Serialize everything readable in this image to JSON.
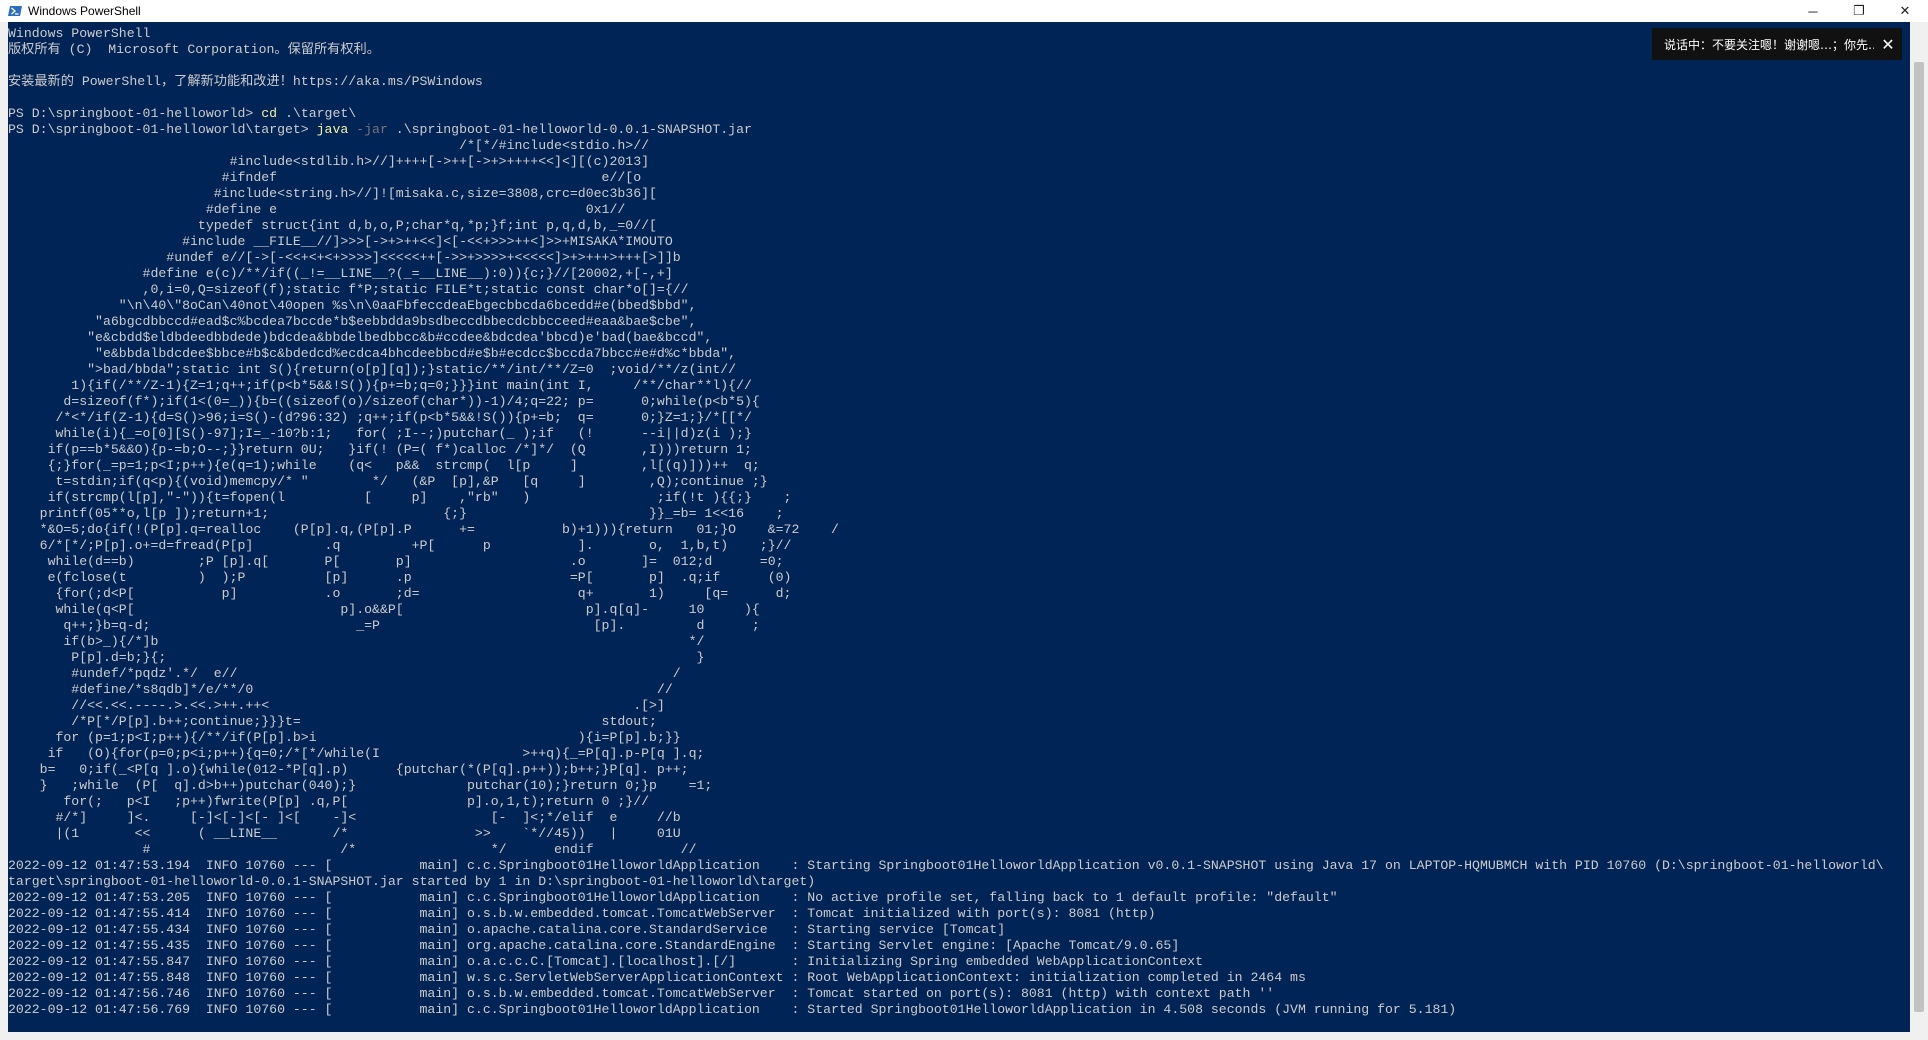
{
  "window": {
    "title": "Windows PowerShell",
    "minimize": "─",
    "maximize": "❐",
    "close": "✕"
  },
  "notification": {
    "text": "说话中：不要关注嗯！谢谢嗯…；你先…",
    "close": "✕"
  },
  "colors": {
    "console_bg": "#012456",
    "text": "#cccccc",
    "command": "#f9f1a5",
    "param": "#767676"
  },
  "console_lines": [
    [
      {
        "t": "Windows PowerShell",
        "c": "a"
      }
    ],
    [
      {
        "t": "版权所有 (C)  Microsoft Corporation。保留所有权利。",
        "c": "a"
      }
    ],
    [
      {
        "t": "",
        "c": "a"
      }
    ],
    [
      {
        "t": "安装最新的 PowerShell，了解新功能和改进！https://aka.ms/PSWindows",
        "c": "a"
      }
    ],
    [
      {
        "t": "",
        "c": "a"
      }
    ],
    [
      {
        "t": "PS D:\\springboot-01-helloworld> ",
        "c": "a"
      },
      {
        "t": "cd",
        "c": "b"
      },
      {
        "t": " .\\target\\",
        "c": "a"
      }
    ],
    [
      {
        "t": "PS D:\\springboot-01-helloworld\\target> ",
        "c": "a"
      },
      {
        "t": "java",
        "c": "b"
      },
      {
        "t": " -jar",
        "c": "c"
      },
      {
        "t": " .\\springboot-01-helloworld-0.0.1-SNAPSHOT.jar",
        "c": "a"
      }
    ],
    [
      {
        "t": "                                                         /*[*/#include<stdio.h>//",
        "c": "a"
      }
    ],
    [
      {
        "t": "                            #include<stdlib.h>//]++++[->++[->+>++++<<]<][(c)2013]",
        "c": "a"
      }
    ],
    [
      {
        "t": "                           #ifndef                                         e//[o",
        "c": "a"
      }
    ],
    [
      {
        "t": "                          #include<string.h>//]![misaka.c,size=3808,crc=d0ec3b36][",
        "c": "a"
      }
    ],
    [
      {
        "t": "                         #define e                                       0x1//",
        "c": "a"
      }
    ],
    [
      {
        "t": "                        typedef struct{int d,b,o,P;char*q,*p;}f;int p,q,d,b,_=0//[",
        "c": "a"
      }
    ],
    [
      {
        "t": "                      #include __FILE__//]>>>[->+>++<<]<[-<<+>>>++<]>>+MISAKA*IMOUTO",
        "c": "a"
      }
    ],
    [
      {
        "t": "                    #undef e//[->[-<<+<+<+>>>>]<<<<<++[->>+>>>>+<<<<<]>+>+++>+++[>]]b",
        "c": "a"
      }
    ],
    [
      {
        "t": "                 #define e(c)/**/if((_!=__LINE__?(_=__LINE__):0)){c;}//[20002,+[-,+]",
        "c": "a"
      }
    ],
    [
      {
        "t": "                 ,0,i=0,Q=sizeof(f);static f*P;static FILE*t;static const char*o[]={//",
        "c": "a"
      }
    ],
    [
      {
        "t": "              \"\\n\\40\\\"8oCan\\40not\\40open %s\\n\\0aaFbfeccdeaEbgecbbcda6bcedd#e(bbed$bbd\",",
        "c": "a"
      }
    ],
    [
      {
        "t": "           \"a6bgcdbbccd#ead$c%bcdea7bccde*b$eebbdda9bsdbeccdbbecdcbbcceed#eaa&bae$cbe\",",
        "c": "a"
      }
    ],
    [
      {
        "t": "          \"e&cbdd$eldbdeedbbdede)bdcdea&bbdelbedbbcc&b#ccdee&bdcdea'bbcd)e'bad(bae&bccd\",",
        "c": "a"
      }
    ],
    [
      {
        "t": "           \"e&bbdalbdcdee$bbce#b$c&bdedcd%ecdca4bhcdeebbcd#e$b#ecdcc$bccda7bbcc#e#d%c*bbda\",",
        "c": "a"
      }
    ],
    [
      {
        "t": "          \">bad/bbda\";static int S(){return(o[p][q]);}static/**/int/**/Z=0  ;void/**/z(int//",
        "c": "a"
      }
    ],
    [
      {
        "t": "        1){if(/**/Z-1){Z=1;q++;if(p<b*5&&!S()){p+=b;q=0;}}}int main(int I,     /**/char**l){//",
        "c": "a"
      }
    ],
    [
      {
        "t": "       d=sizeof(f*);if(1<(0=_)){b=((sizeof(o)/sizeof(char*))-1)/4;q=22; p=      0;while(p<b*5){",
        "c": "a"
      }
    ],
    [
      {
        "t": "      /*<*/if(Z-1){d=S()>96;i=S()-(d?96:32) ;q++;if(p<b*5&&!S()){p+=b;  q=      0;}Z=1;}/*[[*/",
        "c": "a"
      }
    ],
    [
      {
        "t": "      while(i){_=o[0][S()-97];I=_-10?b:1;   for( ;I--;)putchar(_ );if   (!      --i||d)z(i );}",
        "c": "a"
      }
    ],
    [
      {
        "t": "     if(p==b*5&&O){p-=b;O--;}}return 0U;   }if(! (P=( f*)calloc /*]*/  (Q       ,I)))return 1;",
        "c": "a"
      }
    ],
    [
      {
        "t": "     {;}for(_=p=1;p<I;p++){e(q=1);while    (q<   p&&  strcmp(  l[p     ]        ,l[(q)]))++  q;",
        "c": "a"
      }
    ],
    [
      {
        "t": "      t=stdin;if(q<p){(void)memcpy/* \"        */   (&P  [p],&P   [q     ]        ,Q);continue ;}",
        "c": "a"
      }
    ],
    [
      {
        "t": "     if(strcmp(l[p],\"-\")){t=fopen(l          [     p]    ,\"rb\"   )                ;if(!t ){{;}    ;",
        "c": "a"
      }
    ],
    [
      {
        "t": "    printf(05**o,l[p ]);return+1;                      {;}                       }}_=b= 1<<16    ;",
        "c": "a"
      }
    ],
    [
      {
        "t": "    *&O=5;do{if(!(P[p].q=realloc    (P[p].q,(P[p].P      +=           b)+1))){return   01;}O    &=72    /",
        "c": "a"
      }
    ],
    [
      {
        "t": "    6/*[*/;P[p].o+=d=fread(P[p]         .q         +P[      p           ].       o,  1,b,t)    ;}//",
        "c": "a"
      }
    ],
    [
      {
        "t": "     while(d==b)        ;P [p].q[       P[       p]                    .o       ]=  012;d      =0;",
        "c": "a"
      }
    ],
    [
      {
        "t": "     e(fclose(t         )  );P          [p]      .p                    =P[       p]  .q;if      (0)",
        "c": "a"
      }
    ],
    [
      {
        "t": "      {for(;d<P[           p]           .o       ;d=                    q+       1)     [q=      d;",
        "c": "a"
      }
    ],
    [
      {
        "t": "      while(q<P[                          p].o&&P[                       p].q[q]-     10     ){",
        "c": "a"
      }
    ],
    [
      {
        "t": "       q++;}b=q-d;                          _=P                           [p].         d      ;",
        "c": "a"
      }
    ],
    [
      {
        "t": "       if(b>_){/*]b                                                                   */",
        "c": "a"
      }
    ],
    [
      {
        "t": "        P[p].d=b;}{;                                                                   }",
        "c": "a"
      }
    ],
    [
      {
        "t": "        #undef/*pqdz'.*/  e//                                                       /",
        "c": "a"
      }
    ],
    [
      {
        "t": "        #define/*s8qdb]*/e/**/0                                                   //",
        "c": "a"
      }
    ],
    [
      {
        "t": "        //<<.<<.----.>.<<.>++.++<                                              .[>]",
        "c": "a"
      }
    ],
    [
      {
        "t": "        /*P[*/P[p].b++;continue;}}}t=                                      stdout;",
        "c": "a"
      }
    ],
    [
      {
        "t": "      for (p=1;p<I;p++){/**/if(P[p].b>i                                 ){i=P[p].b;}}",
        "c": "a"
      }
    ],
    [
      {
        "t": "     if   (O){for(p=0;p<i;p++){q=0;/*[*/while(I                  >++q){_=P[q].p-P[q ].q;",
        "c": "a"
      }
    ],
    [
      {
        "t": "    b=   0;if(_<P[q ].o){while(012-*P[q].p)      {putchar(*(P[q].p++));b++;}P[q]. p++;",
        "c": "a"
      }
    ],
    [
      {
        "t": "    }   ;while  (P[  q].d>b++)putchar(040);}              putchar(10);}return 0;}p    =1;",
        "c": "a"
      }
    ],
    [
      {
        "t": "       for(;   p<I   ;p++)fwrite(P[p] .q,P[               p].o,1,t);return 0 ;}//",
        "c": "a"
      }
    ],
    [
      {
        "t": "      #/*]     ]<.     [-]<[-]<[- ]<[    -]<                 [-  ]<;*/elif  e     //b",
        "c": "a"
      }
    ],
    [
      {
        "t": "      |(1       <<      ( __LINE__       /*                >>    `*//45))   |     01U",
        "c": "a"
      }
    ],
    [
      {
        "t": "                 #                        /*                 */      endif           //",
        "c": "a"
      }
    ],
    [
      {
        "t": "2022-09-12 01:47:53.194  INFO 10760 --- [           main] c.c.Springboot01HelloworldApplication    : Starting Springboot01HelloworldApplication v0.0.1-SNAPSHOT using Java 17 on LAPTOP-HQMUBMCH with PID 10760 (D:\\springboot-01-helloworld\\",
        "c": "a"
      }
    ],
    [
      {
        "t": "target\\springboot-01-helloworld-0.0.1-SNAPSHOT.jar started by 1 in D:\\springboot-01-helloworld\\target)",
        "c": "a"
      }
    ],
    [
      {
        "t": "2022-09-12 01:47:53.205  INFO 10760 --- [           main] c.c.Springboot01HelloworldApplication    : No active profile set, falling back to 1 default profile: \"default\"",
        "c": "a"
      }
    ],
    [
      {
        "t": "2022-09-12 01:47:55.414  INFO 10760 --- [           main] o.s.b.w.embedded.tomcat.TomcatWebServer  : Tomcat initialized with port(s): 8081 (http)",
        "c": "a"
      }
    ],
    [
      {
        "t": "2022-09-12 01:47:55.434  INFO 10760 --- [           main] o.apache.catalina.core.StandardService   : Starting service [Tomcat]",
        "c": "a"
      }
    ],
    [
      {
        "t": "2022-09-12 01:47:55.435  INFO 10760 --- [           main] org.apache.catalina.core.StandardEngine  : Starting Servlet engine: [Apache Tomcat/9.0.65]",
        "c": "a"
      }
    ],
    [
      {
        "t": "2022-09-12 01:47:55.847  INFO 10760 --- [           main] o.a.c.c.C.[Tomcat].[localhost].[/]       : Initializing Spring embedded WebApplicationContext",
        "c": "a"
      }
    ],
    [
      {
        "t": "2022-09-12 01:47:55.848  INFO 10760 --- [           main] w.s.c.ServletWebServerApplicationContext : Root WebApplicationContext: initialization completed in 2464 ms",
        "c": "a"
      }
    ],
    [
      {
        "t": "2022-09-12 01:47:56.746  INFO 10760 --- [           main] o.s.b.w.embedded.tomcat.TomcatWebServer  : Tomcat started on port(s): 8081 (http) with context path ''",
        "c": "a"
      }
    ],
    [
      {
        "t": "2022-09-12 01:47:56.769  INFO 10760 --- [           main] c.c.Springboot01HelloworldApplication    : Started Springboot01HelloworldApplication in 4.508 seconds (JVM running for 5.181)",
        "c": "a"
      }
    ]
  ]
}
